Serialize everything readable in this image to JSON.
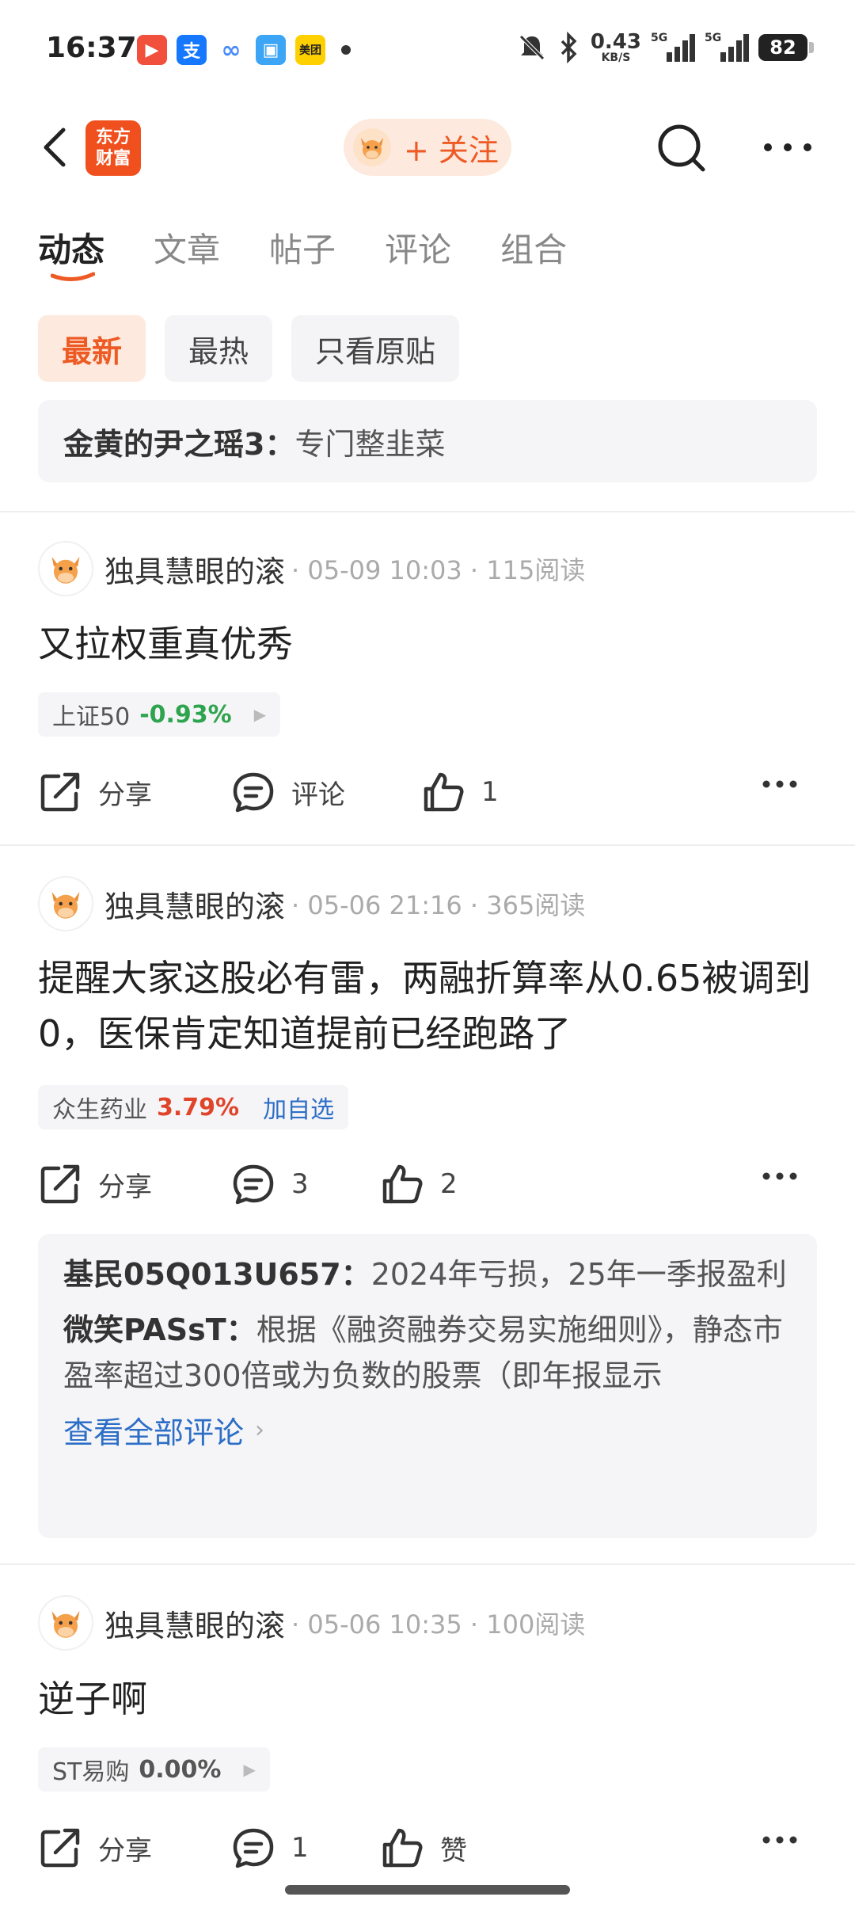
{
  "status_bar": {
    "time": "16:37",
    "net_speed": "0.43",
    "net_unit": "KB/S",
    "sim1": "5G",
    "sim2": "5G",
    "battery": "82",
    "apps": [
      {
        "name": "video-app-icon",
        "glyph": "▶",
        "color": "#f0503c"
      },
      {
        "name": "alipay-icon",
        "glyph": "支",
        "color": "#1677ff"
      },
      {
        "name": "cloud-app-icon",
        "glyph": "∞",
        "color": "#4a8cf7"
      },
      {
        "name": "wallet-app-icon",
        "glyph": "▣",
        "color": "#3da5f5"
      },
      {
        "name": "meituan-icon",
        "glyph": "美团",
        "color": "#ffd000"
      }
    ]
  },
  "header": {
    "logo_line1": "东方",
    "logo_line2": "财富",
    "follow_label": "+ 关注"
  },
  "tabs": [
    "动态",
    "文章",
    "帖子",
    "评论",
    "组合"
  ],
  "filters": [
    "最新",
    "最热",
    "只看原贴"
  ],
  "pinned": {
    "author": "金黄的尹之瑶3：",
    "text": "专门整韭菜"
  },
  "posts": [
    {
      "author": "独具慧眼的滚",
      "info": "· 05-09 10:03 · 115阅读",
      "text": "又拉权重真优秀",
      "stock": {
        "name": "上证50",
        "change": "-0.93%",
        "change_color": "#2ea44f"
      },
      "actions": {
        "share": "分享",
        "comment": "评论",
        "like": "1"
      }
    },
    {
      "author": "独具慧眼的滚",
      "info": "· 05-06 21:16 · 365阅读",
      "text": "提醒大家这股必有雷，两融折算率从0.65被调到0，医保肯定知道提前已经跑路了",
      "stock": {
        "name": "众生药业",
        "change": "3.79%",
        "change_color": "#e0452b",
        "add": "加自选"
      },
      "actions": {
        "share": "分享",
        "comment": "3",
        "like": "2"
      },
      "comments": [
        {
          "author": "基民05Q013U657：",
          "text": "2024年亏损，25年一季报盈利"
        },
        {
          "author": "微笑PASsT：",
          "text": "根据《融资融券交易实施细则》，静态市盈率超过300倍或为负数的股票（即年报显示"
        }
      ],
      "view_all": "查看全部评论"
    },
    {
      "author": "独具慧眼的滚",
      "info": "· 05-06 10:35 · 100阅读",
      "text": "逆子啊",
      "stock": {
        "name": "ST易购",
        "change": "0.00%",
        "change_color": "#555555"
      },
      "actions": {
        "share": "分享",
        "comment": "1",
        "like": "赞"
      }
    }
  ]
}
